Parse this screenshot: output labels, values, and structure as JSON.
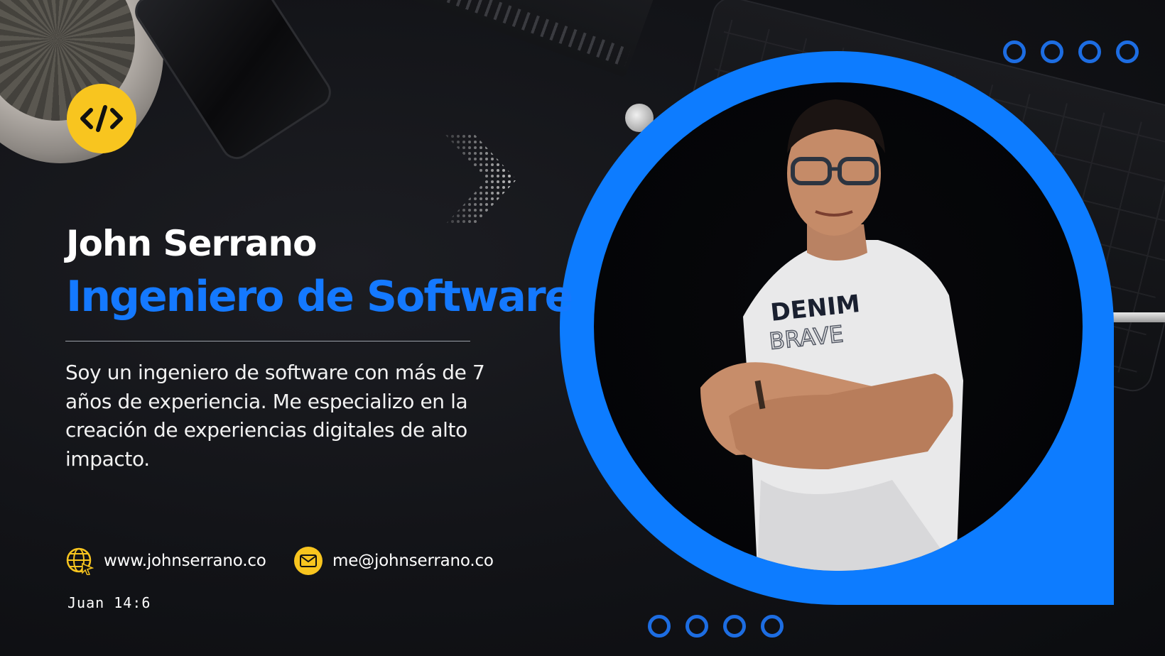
{
  "profile": {
    "name": "John Serrano",
    "role": "Ingeniero de Software",
    "bio": "Soy un ingeniero de software con más de 7 años de experiencia. Me especializo en la creación de experiencias digitales de alto impacto."
  },
  "contact": {
    "website": "www.johnserrano.co",
    "email": "me@johnserrano.co"
  },
  "verse": "Juan  14:6",
  "badge": {
    "icon": "code-icon"
  },
  "colors": {
    "accent_blue": "#0d7cff",
    "accent_yellow": "#f8c51f",
    "background": "#121317",
    "text": "#ffffff"
  }
}
